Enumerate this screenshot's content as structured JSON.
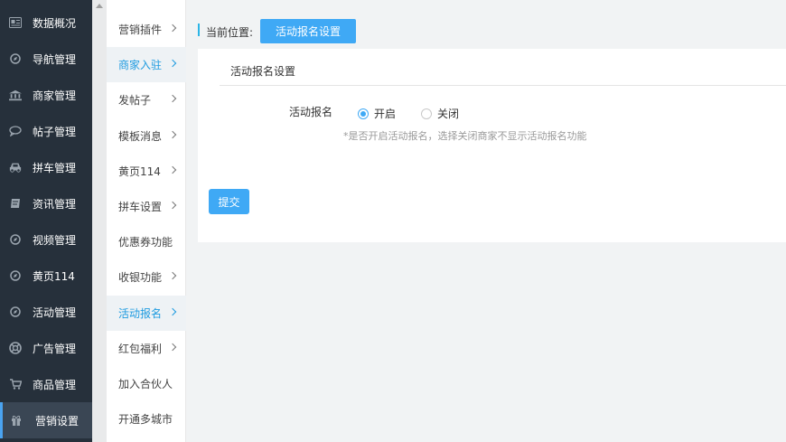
{
  "sidebar": {
    "items": [
      {
        "label": "数据概况",
        "icon": "news-icon"
      },
      {
        "label": "导航管理",
        "icon": "compass-icon"
      },
      {
        "label": "商家管理",
        "icon": "bank-icon"
      },
      {
        "label": "帖子管理",
        "icon": "comment-icon"
      },
      {
        "label": "拼车管理",
        "icon": "car-icon"
      },
      {
        "label": "资讯管理",
        "icon": "book-icon"
      },
      {
        "label": "视频管理",
        "icon": "compass-icon"
      },
      {
        "label": "黄页114",
        "icon": "compass-icon"
      },
      {
        "label": "活动管理",
        "icon": "compass-icon"
      },
      {
        "label": "广告管理",
        "icon": "lifebuoy-icon"
      },
      {
        "label": "商品管理",
        "icon": "cart-icon"
      },
      {
        "label": "营销设置",
        "icon": "gift-icon",
        "active": true
      }
    ]
  },
  "submenu": {
    "items": [
      {
        "label": "营销插件",
        "arrow": true
      },
      {
        "label": "商家入驻",
        "arrow": true,
        "active": true
      },
      {
        "label": "发帖子",
        "arrow": true
      },
      {
        "label": "模板消息",
        "arrow": true
      },
      {
        "label": "黄页114",
        "arrow": true
      },
      {
        "label": "拼车设置",
        "arrow": true
      },
      {
        "label": "优惠券功能",
        "arrow": false
      },
      {
        "label": "收银功能",
        "arrow": true
      },
      {
        "label": "活动报名",
        "arrow": true,
        "active": true
      },
      {
        "label": "红包福利",
        "arrow": true
      },
      {
        "label": "加入合伙人",
        "arrow": false
      },
      {
        "label": "开通多城市",
        "arrow": false
      }
    ]
  },
  "header": {
    "location_label": "当前位置:",
    "current_page": "活动报名设置"
  },
  "panel": {
    "title": "活动报名设置",
    "field_label": "活动报名",
    "option_on": "开启",
    "option_off": "关闭",
    "selected": "开启",
    "hint": "*是否开启活动报名，选择关闭商家不显示活动报名功能",
    "submit_label": "提交"
  },
  "colors": {
    "sidebar_bg": "#26303b",
    "accent": "#3fa9f5",
    "active_text": "#1e9be0"
  }
}
